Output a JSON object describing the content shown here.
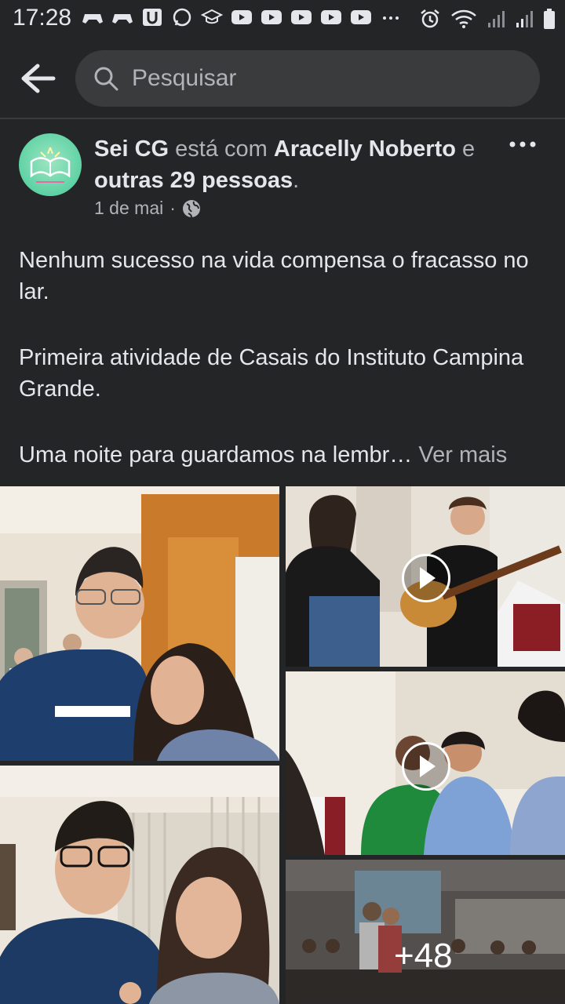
{
  "status": {
    "time": "17:28"
  },
  "search": {
    "placeholder": "Pesquisar"
  },
  "post": {
    "author": "Sei CG",
    "with_text": "está com",
    "tagged": "Aracelly Noberto",
    "conj": "e",
    "others": "outras 29 pessoas",
    "period": ".",
    "date": "1 de mai",
    "dot": "·",
    "paragraphs": [
      "Nenhum sucesso na vida compensa o fracasso no lar.",
      "Primeira atividade de Casais do Instituto Campina Grande.",
      "Uma noite para guardamos na lembr…"
    ],
    "see_more": "Ver mais",
    "more_photos": "+48"
  },
  "icons": {
    "back": "arrow-left-icon",
    "search": "search-icon",
    "more": "more-options-icon",
    "privacy": "globe-icon",
    "play": "play-icon"
  },
  "colors": {
    "background": "#242526",
    "search_bg": "#3a3b3c",
    "text": "#e4e6eb",
    "secondary": "#b0b3b8",
    "avatar": "#5ed2a4"
  }
}
